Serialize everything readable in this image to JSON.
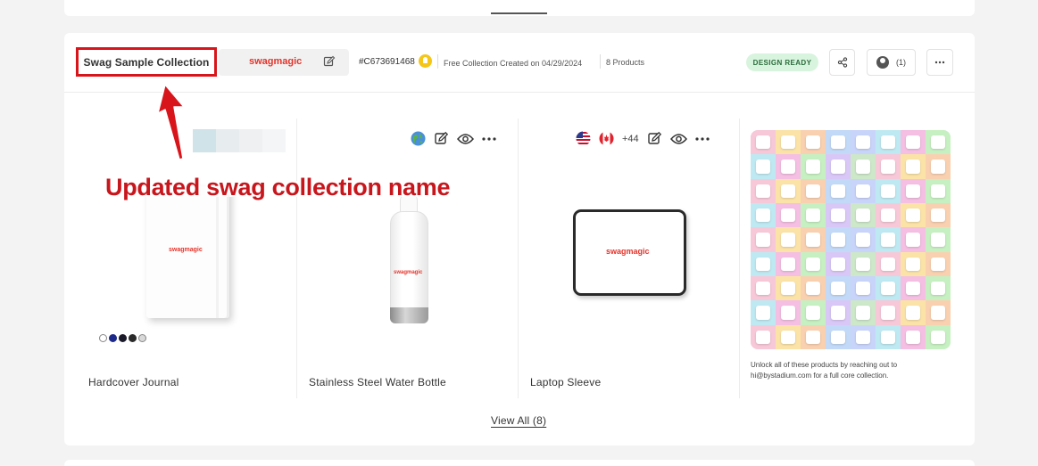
{
  "collection": {
    "name": "Swag Sample Collection",
    "brand": "swagmagic",
    "id": "#C673691468",
    "created": "Free Collection Created on 04/29/2024",
    "products_count": "8 Products",
    "status": "DESIGN READY",
    "members": "(1)"
  },
  "products": [
    {
      "name": "Hardcover Journal",
      "logo": "swagmagic",
      "swatches": [
        "#ffffff",
        "#1e2a8a",
        "#1a1a2a",
        "#2b2b2b",
        "#d9d9d9"
      ],
      "icons": []
    },
    {
      "name": "Stainless Steel Water Bottle",
      "logo": "swagmagic",
      "icons": [
        "globe-icon",
        "edit-icon",
        "eye-icon",
        "more-icon"
      ]
    },
    {
      "name": "Laptop Sleeve",
      "logo": "swagmagic",
      "icons": [
        "us-flag-icon",
        "ca-flag-icon",
        "edit-icon",
        "eye-icon",
        "more-icon"
      ],
      "extra_regions": "+44"
    }
  ],
  "unlock_text": "Unlock all of these products by reaching out to hi@bystadium.com for a full core collection.",
  "view_all": "View All (8)",
  "annotation": "Updated swag collection name",
  "colors": {
    "accent_red": "#e5332a",
    "annotation_red": "#c8161d",
    "status_green_bg": "#d8f4de"
  }
}
